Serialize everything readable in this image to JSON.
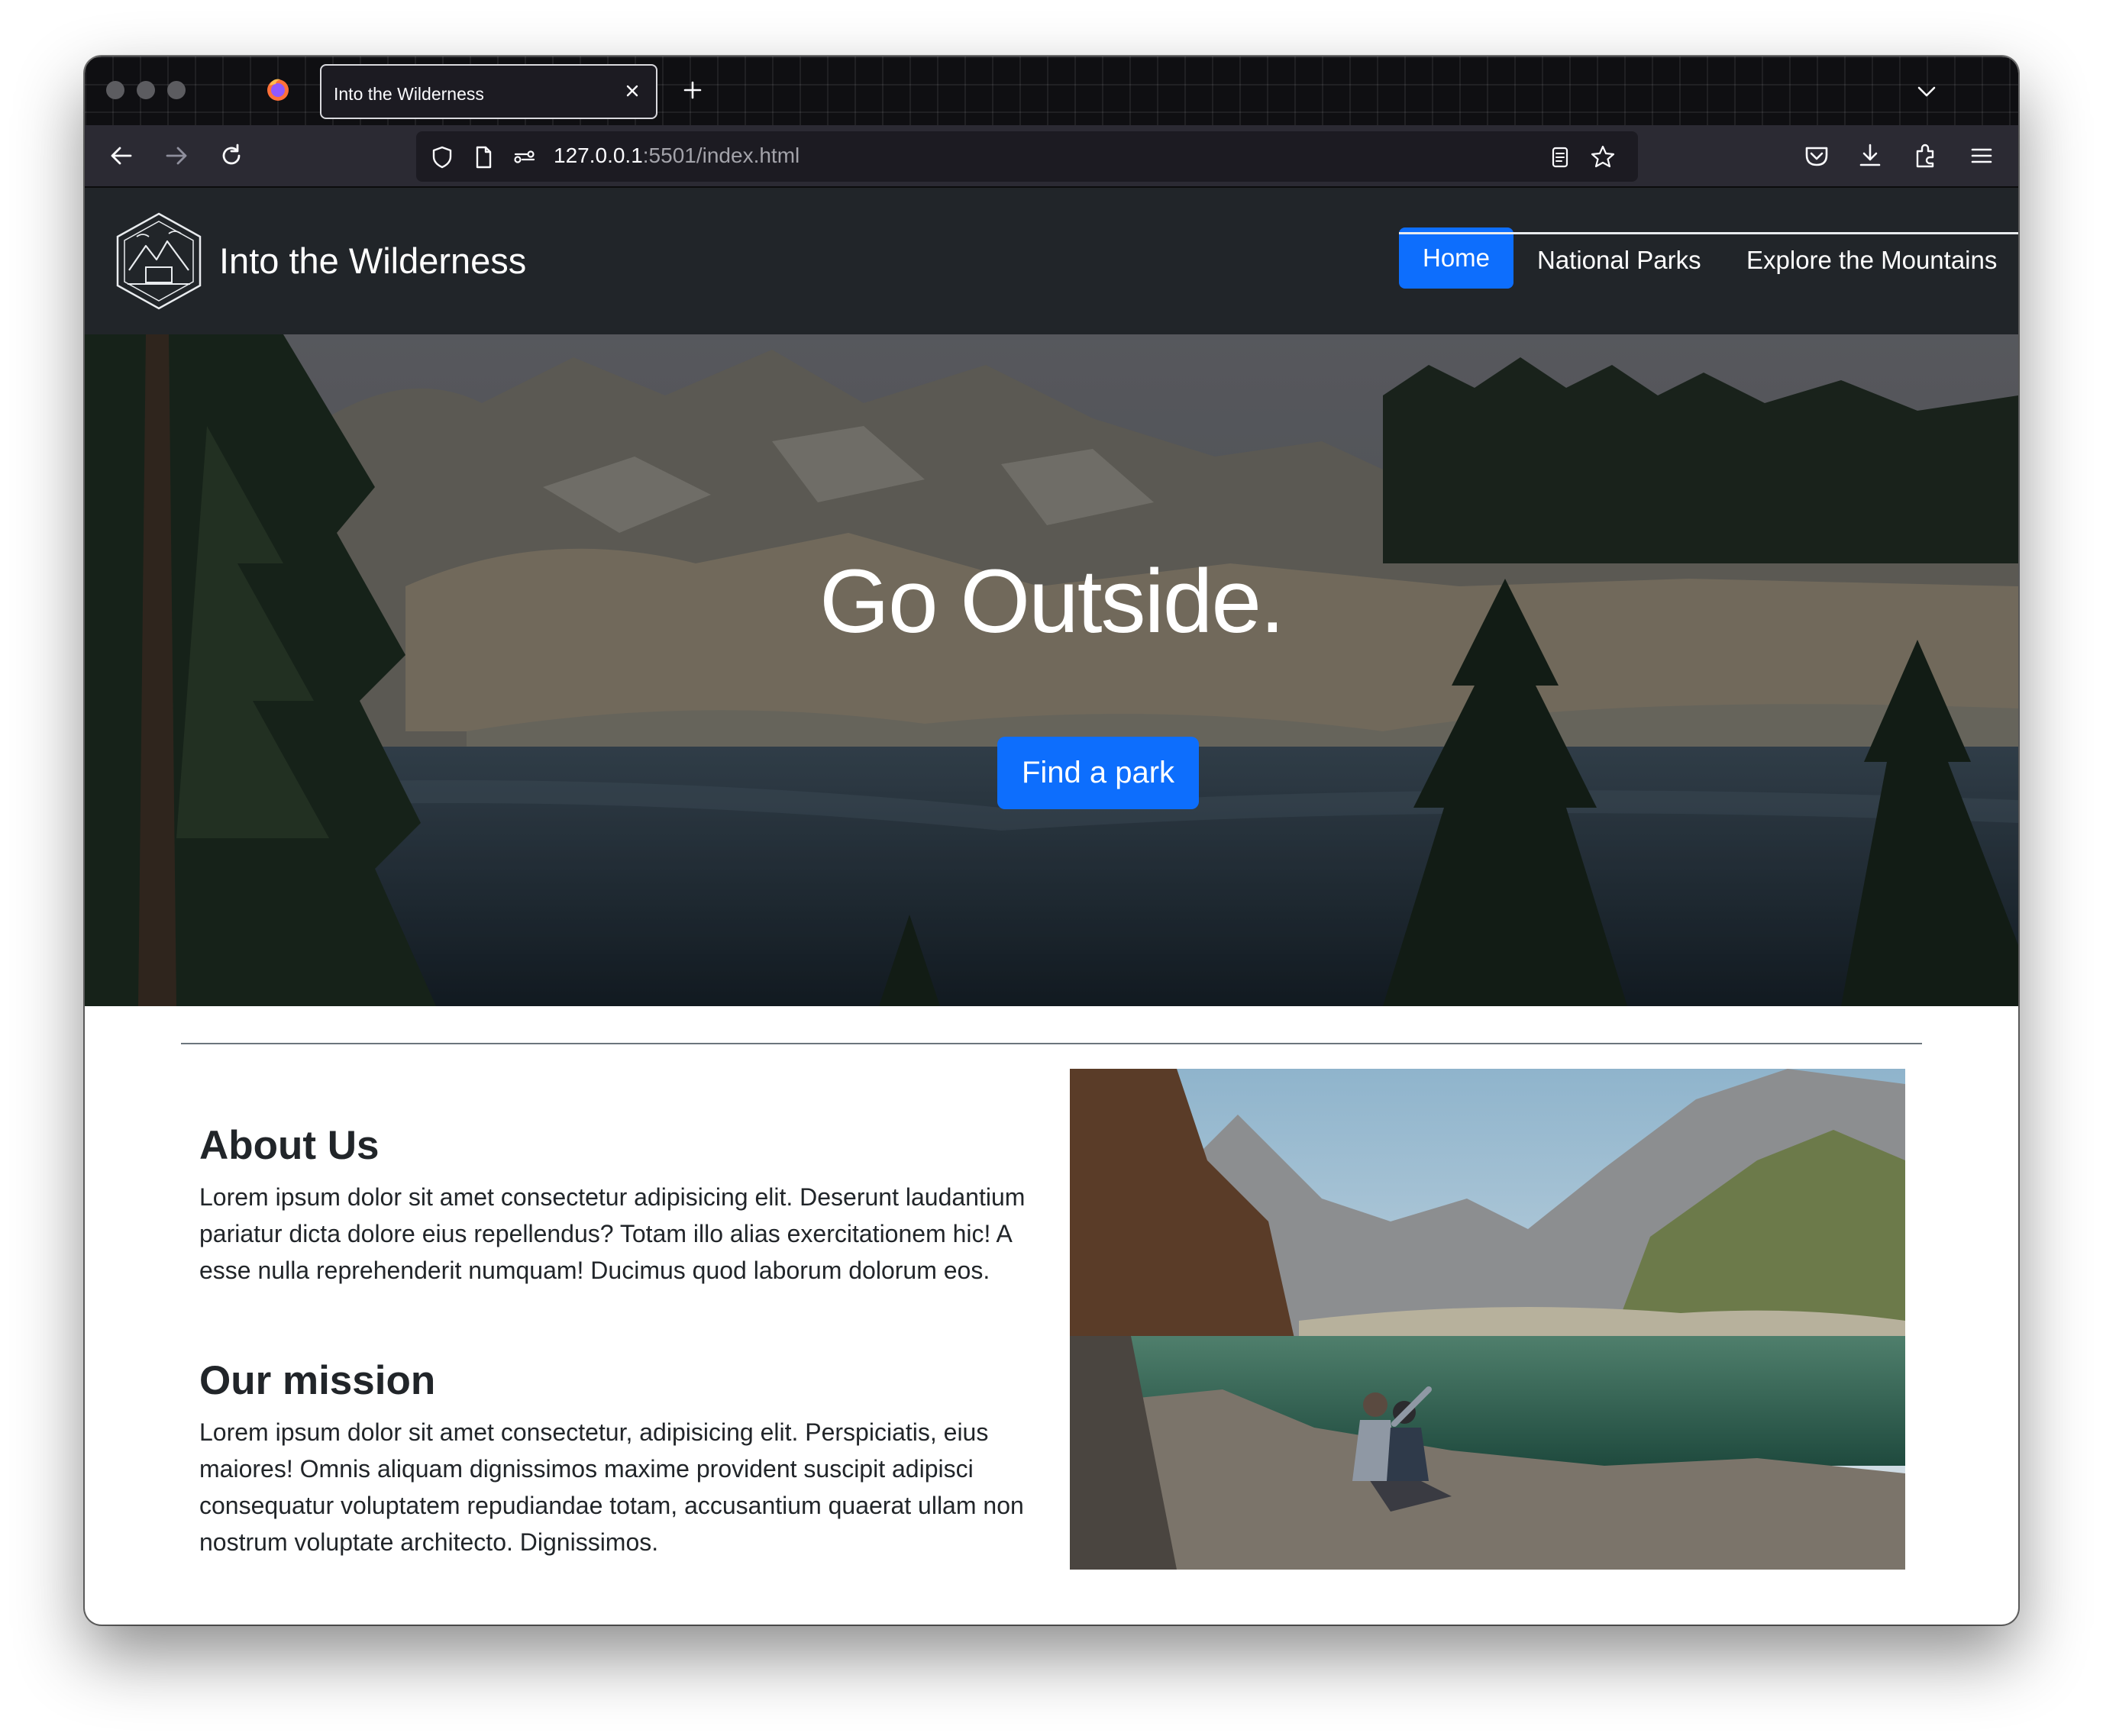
{
  "browser": {
    "tab_title": "Into the Wilderness",
    "url_host": "127.0.0.1",
    "url_path": ":5501/index.html"
  },
  "site": {
    "brand": "Into the Wilderness",
    "nav": {
      "home": "Home",
      "national_parks": "National Parks",
      "explore": "Explore the Mountains"
    },
    "hero": {
      "title": "Go Outside.",
      "button": "Find a park"
    },
    "about": {
      "heading": "About Us",
      "text": "Lorem ipsum dolor sit amet consectetur adipisicing elit. Deserunt laudantium pariatur dicta dolore eius repellendus? Totam illo alias exercitationem hic! A esse nulla reprehenderit numquam! Ducimus quod laborum dolorum eos."
    },
    "mission": {
      "heading": "Our mission",
      "text": "Lorem ipsum dolor sit amet consectetur, adipisicing elit. Perspiciatis, eius maiores! Omnis aliquam dignissimos maxime provident suscipit adipisci consequatur voluptatem repudiandae totam, accusantium quaerat ullam non nostrum voluptate architecto. Dignissimos."
    }
  },
  "colors": {
    "primary": "#0d6efd",
    "navbar": "#212529",
    "toolbar": "#2b2a33"
  }
}
